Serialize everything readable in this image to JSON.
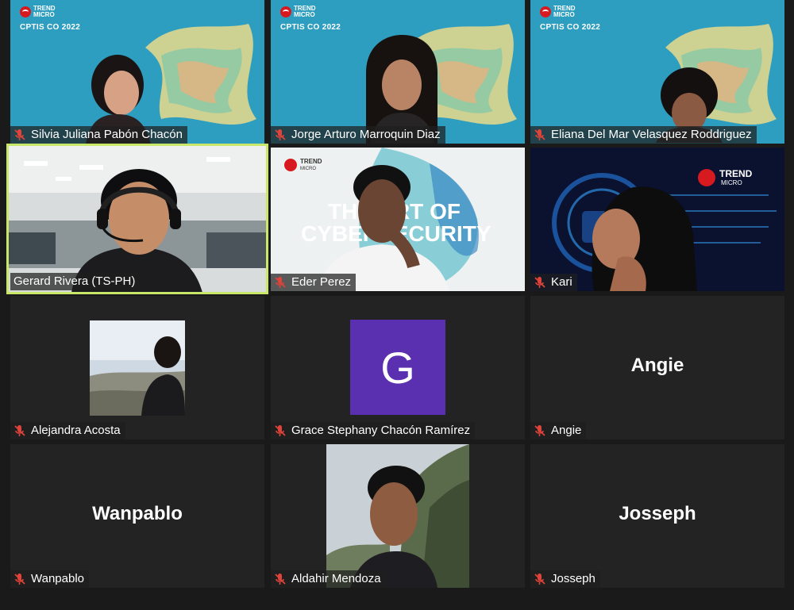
{
  "event": {
    "brand_line1": "TREND",
    "brand_line2": "MICRO",
    "title": "CPTIS CO 2022"
  },
  "participants": [
    {
      "name": "Silvia Juliana Pabón Chacón",
      "muted": true
    },
    {
      "name": "Jorge Arturo Marroquin Diaz",
      "muted": true
    },
    {
      "name": "Eliana Del Mar Velasquez Roddriguez",
      "muted": true
    },
    {
      "name": "Gerard Rivera (TS-PH)",
      "muted": false,
      "active_speaker": true
    },
    {
      "name": "Eder Perez",
      "muted": true
    },
    {
      "name": "Kari",
      "muted": true
    },
    {
      "name": "Alejandra Acosta",
      "muted": true
    },
    {
      "name": "Grace Stephany Chacón Ramírez",
      "muted": true,
      "initial": "G"
    },
    {
      "name": "Angie",
      "muted": true,
      "display_name": "Angie"
    },
    {
      "name": "Wanpablo",
      "muted": true,
      "display_name": "Wanpablo"
    },
    {
      "name": "Aldahir Mendoza",
      "muted": true
    },
    {
      "name": "Josseph",
      "muted": true,
      "display_name": "Josseph"
    }
  ],
  "slide": {
    "line1": "THE ART OF",
    "line2": "CYBERSECURITY"
  },
  "colors": {
    "banner": "#2e9ec0",
    "active_outline": "#c9e86b",
    "mute_red": "#e0433a",
    "grace_avatar": "#5a2fb0"
  }
}
